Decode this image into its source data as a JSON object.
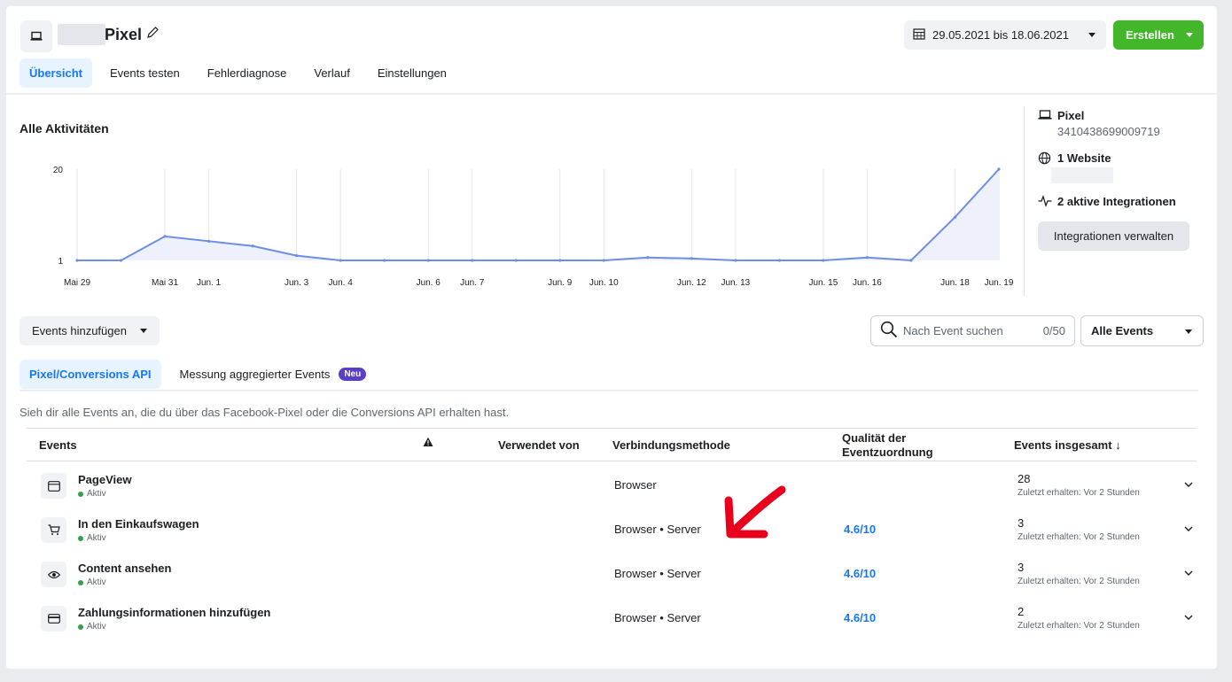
{
  "header": {
    "title": "Pixel",
    "date_range": "29.05.2021 bis 18.06.2021",
    "create_label": "Erstellen"
  },
  "tabs": [
    {
      "label": "Übersicht",
      "active": true
    },
    {
      "label": "Events testen"
    },
    {
      "label": "Fehlerdiagnose"
    },
    {
      "label": "Verlauf"
    },
    {
      "label": "Einstellungen"
    }
  ],
  "chart": {
    "title": "Alle Aktivitäten"
  },
  "chart_data": {
    "type": "area",
    "x": [
      "Mai 29",
      "Mai 30",
      "Mai 31",
      "Jun. 1",
      "Jun. 2",
      "Jun. 3",
      "Jun. 4",
      "Jun. 5",
      "Jun. 6",
      "Jun. 7",
      "Jun. 8",
      "Jun. 9",
      "Jun. 10",
      "Jun. 11",
      "Jun. 12",
      "Jun. 13",
      "Jun. 14",
      "Jun. 15",
      "Jun. 16",
      "Jun. 17",
      "Jun. 18",
      "Jun. 19"
    ],
    "tick_labels": [
      "Mai 29",
      "Mai 31",
      "Jun. 1",
      "Jun. 3",
      "Jun. 4",
      "Jun. 6",
      "Jun. 7",
      "Jun. 9",
      "Jun. 10",
      "Jun. 12",
      "Jun. 13",
      "Jun. 15",
      "Jun. 16",
      "Jun. 18",
      "Jun. 19"
    ],
    "series": [
      {
        "values": [
          1,
          1,
          6,
          5,
          4,
          2,
          1,
          1,
          1,
          1,
          1,
          1,
          1,
          1.6,
          1.4,
          1,
          1,
          1,
          1.6,
          1,
          10,
          20
        ]
      }
    ],
    "y_ticks": [
      "1",
      "20"
    ],
    "ylim": [
      1,
      20
    ],
    "grid": "vertical",
    "color": "#6d8ee6",
    "fill": "#eef1fb"
  },
  "side": {
    "pixel_label": "Pixel",
    "pixel_id": "3410438699009719",
    "website_label": "1 Website",
    "integrations_label": "2 aktive Integrationen",
    "manage_label": "Integrationen verwalten"
  },
  "controls": {
    "add_events_label": "Events hinzufügen",
    "search_placeholder": "Nach Event suchen",
    "search_count": "0/50",
    "filter_label": "Alle Events"
  },
  "subtabs": [
    {
      "label": "Pixel/Conversions API",
      "active": true
    },
    {
      "label": "Messung aggregierter Events",
      "badge": "Neu"
    }
  ],
  "description": "Sieh dir alle Events an, die du über das Facebook-Pixel oder die Conversions API erhalten hast.",
  "table": {
    "headers": {
      "events": "Events",
      "used_by": "Verwendet von",
      "method": "Verbindungsmethode",
      "quality_1": "Qualität der",
      "quality_2": "Eventzuordnung",
      "total": "Events insgesamt ↓"
    },
    "rows": [
      {
        "name": "PageView",
        "status": "Aktiv",
        "method": "Browser",
        "quality": "",
        "total": "28",
        "last": "Zuletzt erhalten: Vor 2 Stunden"
      },
      {
        "name": "In den Einkaufswagen",
        "status": "Aktiv",
        "method": "Browser • Server",
        "quality": "4.6/10",
        "total": "3",
        "last": "Zuletzt erhalten: Vor 2 Stunden"
      },
      {
        "name": "Content ansehen",
        "status": "Aktiv",
        "method": "Browser • Server",
        "quality": "4.6/10",
        "total": "3",
        "last": "Zuletzt erhalten: Vor 2 Stunden"
      },
      {
        "name": "Zahlungsinformationen hinzufügen",
        "status": "Aktiv",
        "method": "Browser • Server",
        "quality": "4.6/10",
        "total": "2",
        "last": "Zuletzt erhalten: Vor 2 Stunden"
      }
    ]
  },
  "colors": {
    "accent": "#1877f2",
    "create": "#42b72a",
    "active_dot": "#31a24c",
    "badge": "#5b3ec8",
    "annotation_arrow": "#e8001c"
  }
}
